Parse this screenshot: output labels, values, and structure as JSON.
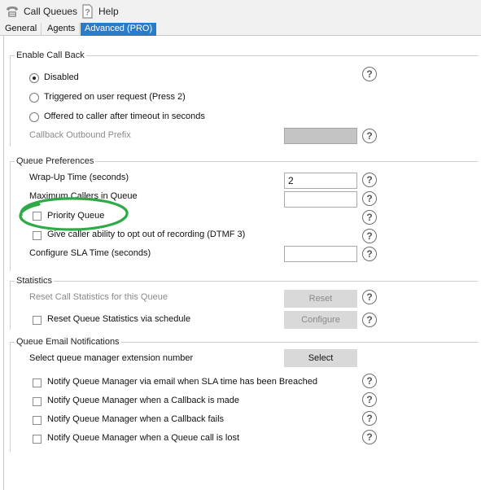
{
  "toolbar": {
    "call_queues_label": "Call Queues",
    "help_label": "Help",
    "call_queues_icon": "phone-icon",
    "help_icon": "help-icon"
  },
  "tabs": [
    {
      "label": "General",
      "active": false
    },
    {
      "label": "Agents",
      "active": false
    },
    {
      "label": "Advanced (PRO)",
      "active": true
    }
  ],
  "enable_callback": {
    "title": "Enable Call Back",
    "options": [
      {
        "label": "Disabled",
        "selected": true
      },
      {
        "label": "Triggered on user request (Press 2)",
        "selected": false
      },
      {
        "label": "Offered to caller after timeout in seconds",
        "selected": false
      }
    ],
    "prefix_label": "Callback Outbound Prefix",
    "prefix_value": ""
  },
  "queue_preferences": {
    "title": "Queue Preferences",
    "wrap_up_label": "Wrap-Up Time (seconds)",
    "wrap_up_value": "2",
    "max_callers_label": "Maximum Callers in Queue",
    "max_callers_value": "",
    "priority_queue_label": "Priority Queue",
    "opt_out_label": "Give caller ability to opt out of recording (DTMF 3)",
    "sla_label": "Configure SLA Time (seconds)",
    "sla_value": ""
  },
  "statistics": {
    "title": "Statistics",
    "reset_label": "Reset Call Statistics for this Queue",
    "reset_button": "Reset",
    "schedule_label": "Reset Queue Statistics via schedule",
    "configure_button": "Configure"
  },
  "email_notifications": {
    "title": "Queue Email Notifications",
    "manager_label": "Select queue manager extension number",
    "select_button": "Select",
    "items": [
      {
        "label": "Notify Queue Manager via email when SLA time has been Breached"
      },
      {
        "label": "Notify Queue Manager when a Callback is made"
      },
      {
        "label": "Notify Queue Manager when a Callback fails"
      },
      {
        "label": "Notify Queue Manager when a Queue call is lost"
      }
    ]
  },
  "help_glyph": "?",
  "colors": {
    "tab_active": "#2b7cc7",
    "annotation": "#2eaa47",
    "disabled_field": "#c4c4c4",
    "button": "#d9d9d9"
  }
}
